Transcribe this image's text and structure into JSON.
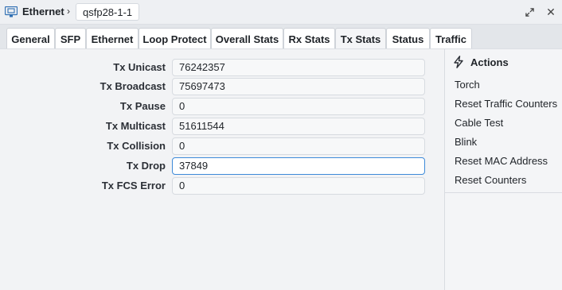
{
  "titlebar": {
    "title": "Ethernet",
    "chevron": "›",
    "item_name": "qsfp28-1-1",
    "close_glyph": "✕"
  },
  "tabs": [
    {
      "label": "General"
    },
    {
      "label": "SFP"
    },
    {
      "label": "Ethernet"
    },
    {
      "label": "Loop Protect"
    },
    {
      "label": "Overall Stats"
    },
    {
      "label": "Rx Stats"
    },
    {
      "label": "Tx Stats",
      "active": true
    },
    {
      "label": "Status"
    },
    {
      "label": "Traffic"
    }
  ],
  "fields": [
    {
      "label": "Tx Unicast",
      "value": "76242357"
    },
    {
      "label": "Tx Broadcast",
      "value": "75697473"
    },
    {
      "label": "Tx Pause",
      "value": "0"
    },
    {
      "label": "Tx Multicast",
      "value": "51611544"
    },
    {
      "label": "Tx Collision",
      "value": "0"
    },
    {
      "label": "Tx Drop",
      "value": "37849",
      "focused": true
    },
    {
      "label": "Tx FCS Error",
      "value": "0"
    }
  ],
  "actions": {
    "title": "Actions",
    "icon": "lightning-icon",
    "items": [
      {
        "label": "Torch"
      },
      {
        "label": "Reset Traffic Counters"
      },
      {
        "label": "Cable Test"
      },
      {
        "label": "Blink"
      },
      {
        "label": "Reset MAC Address"
      },
      {
        "label": "Reset Counters"
      }
    ]
  },
  "colors": {
    "focus_border": "#3d8ad9",
    "interface_icon": "#2f6fb3"
  }
}
